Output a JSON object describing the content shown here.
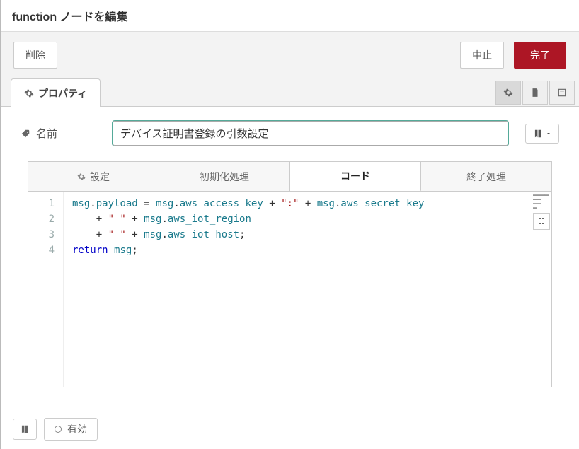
{
  "header": {
    "title": "function ノードを編集"
  },
  "toolbar": {
    "delete": "削除",
    "cancel": "中止",
    "done": "完了"
  },
  "mainTab": {
    "label": "プロパティ"
  },
  "nameRow": {
    "label": "名前",
    "value": "デバイス証明書登録の引数設定"
  },
  "innerTabs": {
    "setup": "設定",
    "init": "初期化処理",
    "code": "コード",
    "close": "終了処理"
  },
  "code": {
    "lines": [
      "1",
      "2",
      "3",
      "4"
    ],
    "l1a": "msg",
    "l1b": ".",
    "l1c": "payload",
    "l1d": " = ",
    "l1e": "msg",
    "l1f": ".",
    "l1g": "aws_access_key",
    "l1h": " + ",
    "l1i": "\":\"",
    "l1j": " + ",
    "l1k": "msg",
    "l1l": ".",
    "l1m": "aws_secret_key",
    "l2a": "    + ",
    "l2b": "\" \"",
    "l2c": " + ",
    "l2d": "msg",
    "l2e": ".",
    "l2f": "aws_iot_region",
    "l3a": "    + ",
    "l3b": "\" \"",
    "l3c": " + ",
    "l3d": "msg",
    "l3e": ".",
    "l3f": "aws_iot_host",
    "l3g": ";",
    "l4a": "return",
    "l4b": " ",
    "l4c": "msg",
    "l4d": ";"
  },
  "footer": {
    "status": "有効"
  }
}
